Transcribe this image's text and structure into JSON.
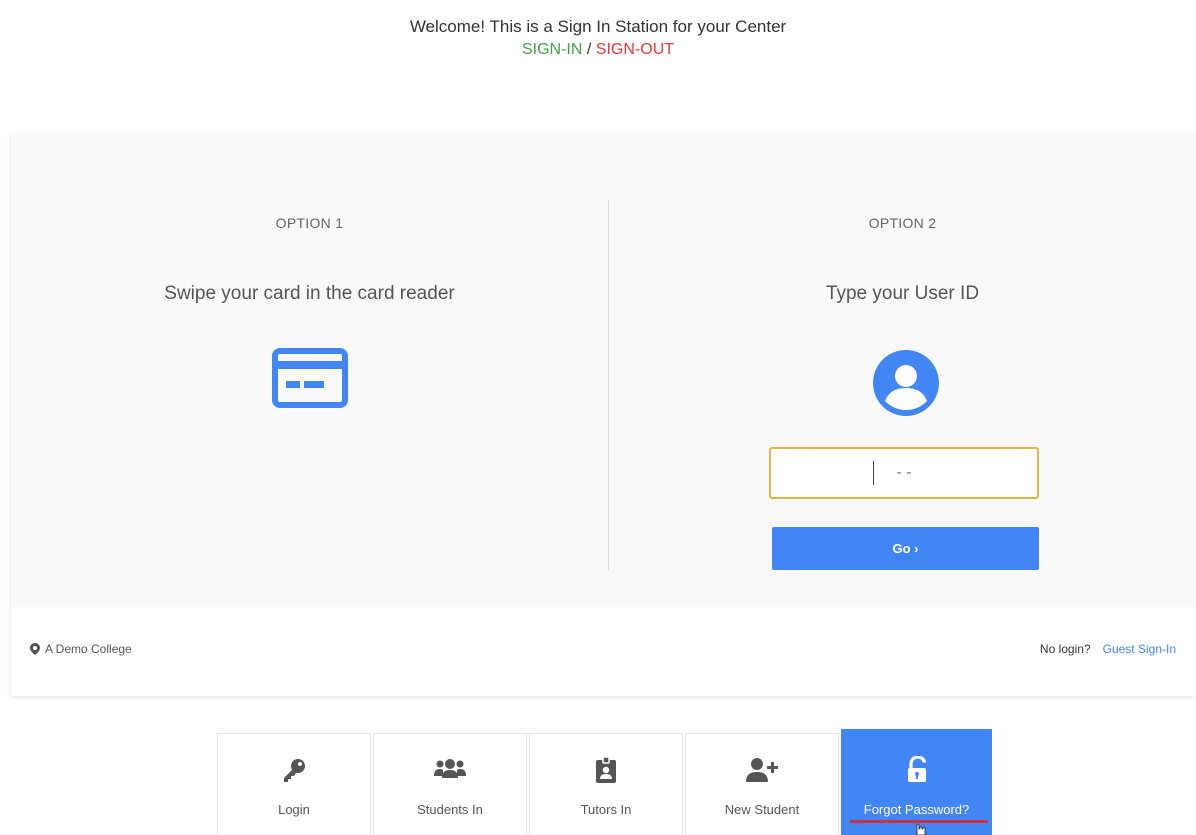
{
  "header": {
    "welcome": "Welcome! This is a  Sign In Station for your Center",
    "signin_link": "SIGN-IN",
    "separator": "/",
    "signout_link": "SIGN-OUT",
    "signin_color": "#43a047",
    "signout_color": "#e53935"
  },
  "option1": {
    "label": "OPTION 1",
    "description": "Swipe your card in the card reader",
    "icon": "credit-card-icon"
  },
  "option2": {
    "label": "OPTION 2",
    "description": "Type your User ID",
    "icon": "user-circle-icon",
    "input_placeholder": "- -",
    "input_value": "",
    "go_label": "Go ›"
  },
  "footer": {
    "location_icon": "map-marker-icon",
    "location": "A Demo College",
    "no_login": "No login?",
    "guest_signin": "Guest Sign-In"
  },
  "tabs": [
    {
      "label": "Login",
      "icon": "key-icon",
      "active": false
    },
    {
      "label": "Students In",
      "icon": "users-icon",
      "active": false
    },
    {
      "label": "Tutors In",
      "icon": "id-badge-icon",
      "active": false
    },
    {
      "label": "New Student",
      "icon": "user-plus-icon",
      "active": false
    },
    {
      "label": "Forgot Password?",
      "icon": "unlock-icon",
      "active": true
    }
  ],
  "colors": {
    "accent": "#4285f4",
    "input_border": "#e0b54a",
    "highlight_underline": "#d32f3a"
  }
}
